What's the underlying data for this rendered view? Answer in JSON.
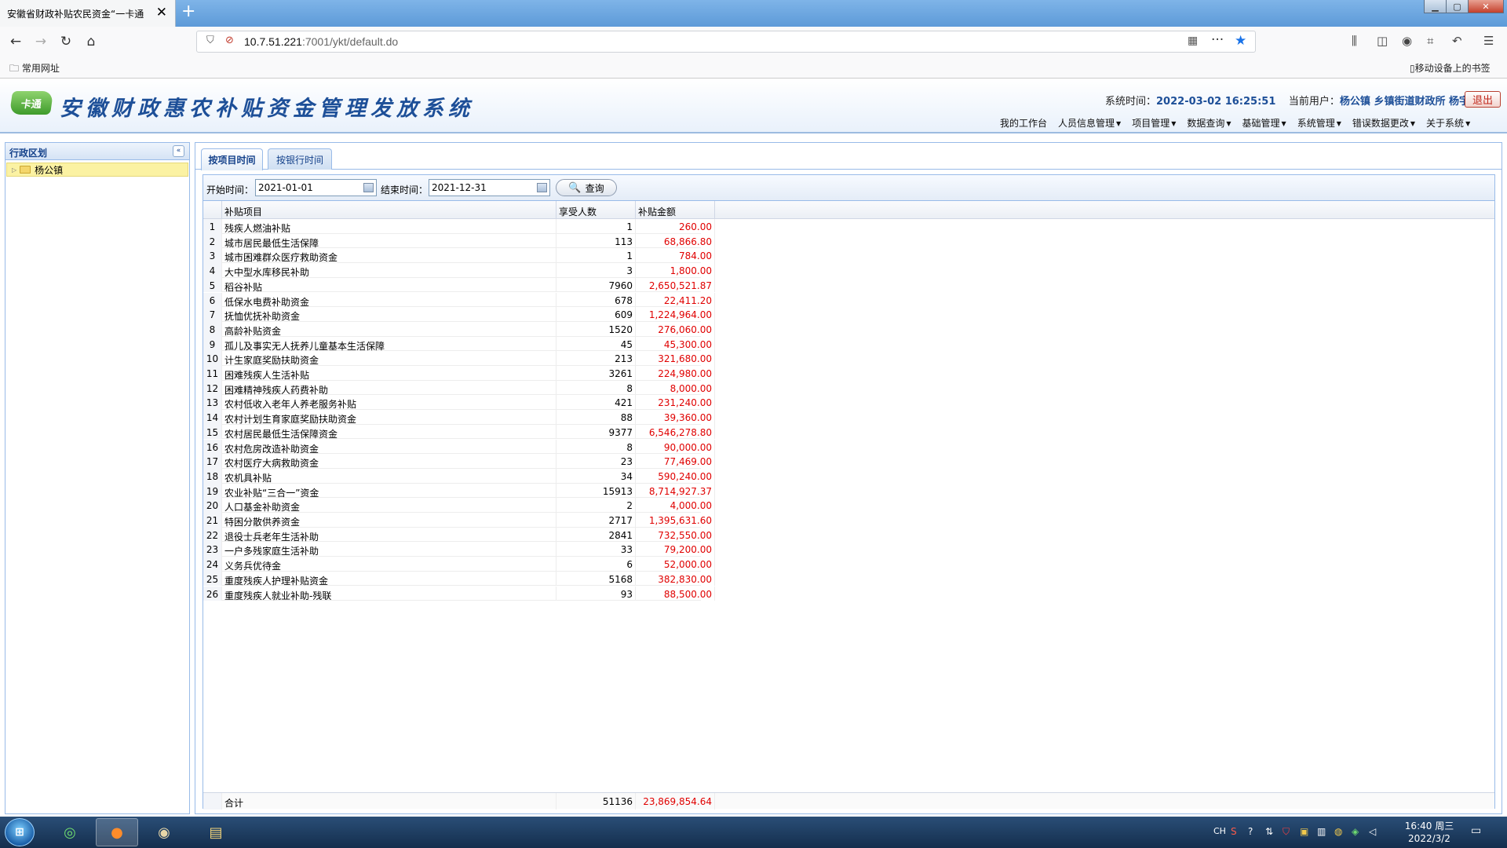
{
  "browser": {
    "tab_title": "安徽省财政补贴农民资金“一卡通",
    "url_host": "10.7.51.221",
    "url_path": ":7001/ykt/default.do",
    "bookmark_folder": "常用网址",
    "mobile_bookmarks": "移动设备上的书签"
  },
  "app": {
    "logo_text": "卡通",
    "title": "安徽财政惠农补贴资金管理发放系统",
    "system_time_label": "系统时间：",
    "system_time": "2022-03-02 16:25:51",
    "current_user_label": "当前用户：",
    "current_user": "杨公镇 乡镇街道财政所 杨宇",
    "logout": "退出"
  },
  "menu": [
    {
      "label": "我的工作台",
      "dropdown": false
    },
    {
      "label": "人员信息管理",
      "dropdown": true
    },
    {
      "label": "项目管理",
      "dropdown": true
    },
    {
      "label": "数据查询",
      "dropdown": true
    },
    {
      "label": "基础管理",
      "dropdown": true
    },
    {
      "label": "系统管理",
      "dropdown": true
    },
    {
      "label": "错误数据更改",
      "dropdown": true
    },
    {
      "label": "关于系统",
      "dropdown": true
    }
  ],
  "sidebar": {
    "title": "行政区划",
    "tree": [
      {
        "label": "杨公镇"
      }
    ]
  },
  "tabs": [
    {
      "label": "按项目时间",
      "active": true
    },
    {
      "label": "按银行时间",
      "active": false
    }
  ],
  "filter": {
    "start_label": "开始时间：",
    "start_date": "2021-01-01",
    "end_label": "结束时间：",
    "end_date": "2021-12-31",
    "query_label": "查询"
  },
  "table": {
    "columns": [
      "补贴项目",
      "享受人数",
      "补贴金额"
    ],
    "rows": [
      {
        "idx": "1",
        "name": "残疾人燃油补贴",
        "count": "1",
        "amount": "260.00"
      },
      {
        "idx": "2",
        "name": "城市居民最低生活保障",
        "count": "113",
        "amount": "68,866.80"
      },
      {
        "idx": "3",
        "name": "城市困难群众医疗救助资金",
        "count": "1",
        "amount": "784.00"
      },
      {
        "idx": "4",
        "name": "大中型水库移民补助",
        "count": "3",
        "amount": "1,800.00"
      },
      {
        "idx": "5",
        "name": "稻谷补贴",
        "count": "7960",
        "amount": "2,650,521.87"
      },
      {
        "idx": "6",
        "name": "低保水电费补助资金",
        "count": "678",
        "amount": "22,411.20"
      },
      {
        "idx": "7",
        "name": "抚恤优抚补助资金",
        "count": "609",
        "amount": "1,224,964.00"
      },
      {
        "idx": "8",
        "name": "高龄补贴资金",
        "count": "1520",
        "amount": "276,060.00"
      },
      {
        "idx": "9",
        "name": "孤儿及事实无人抚养儿童基本生活保障",
        "count": "45",
        "amount": "45,300.00"
      },
      {
        "idx": "10",
        "name": "计生家庭奖励扶助资金",
        "count": "213",
        "amount": "321,680.00"
      },
      {
        "idx": "11",
        "name": "困难残疾人生活补贴",
        "count": "3261",
        "amount": "224,980.00"
      },
      {
        "idx": "12",
        "name": "困难精神残疾人药费补助",
        "count": "8",
        "amount": "8,000.00"
      },
      {
        "idx": "13",
        "name": "农村低收入老年人养老服务补贴",
        "count": "421",
        "amount": "231,240.00"
      },
      {
        "idx": "14",
        "name": "农村计划生育家庭奖励扶助资金",
        "count": "88",
        "amount": "39,360.00"
      },
      {
        "idx": "15",
        "name": "农村居民最低生活保障资金",
        "count": "9377",
        "amount": "6,546,278.80"
      },
      {
        "idx": "16",
        "name": "农村危房改造补助资金",
        "count": "8",
        "amount": "90,000.00"
      },
      {
        "idx": "17",
        "name": "农村医疗大病救助资金",
        "count": "23",
        "amount": "77,469.00"
      },
      {
        "idx": "18",
        "name": "农机具补贴",
        "count": "34",
        "amount": "590,240.00"
      },
      {
        "idx": "19",
        "name": "农业补贴“三合一”资金",
        "count": "15913",
        "amount": "8,714,927.37"
      },
      {
        "idx": "20",
        "name": "人口基金补助资金",
        "count": "2",
        "amount": "4,000.00"
      },
      {
        "idx": "21",
        "name": "特困分散供养资金",
        "count": "2717",
        "amount": "1,395,631.60"
      },
      {
        "idx": "22",
        "name": "退役士兵老年生活补助",
        "count": "2841",
        "amount": "732,550.00"
      },
      {
        "idx": "23",
        "name": "一户多残家庭生活补助",
        "count": "33",
        "amount": "79,200.00"
      },
      {
        "idx": "24",
        "name": "义务兵优待金",
        "count": "6",
        "amount": "52,000.00"
      },
      {
        "idx": "25",
        "name": "重度残疾人护理补贴资金",
        "count": "5168",
        "amount": "382,830.00"
      },
      {
        "idx": "26",
        "name": "重度残疾人就业补助-残联",
        "count": "93",
        "amount": "88,500.00"
      }
    ],
    "total": {
      "label": "合计",
      "count": "51136",
      "amount": "23,869,854.64"
    }
  },
  "taskbar": {
    "ime": "CH",
    "time": "16:40 周三",
    "date": "2022/3/2"
  },
  "colors": {
    "amount_red": "#e00000",
    "title_blue": "#1d4f98",
    "panel_border": "#99bbe8"
  }
}
